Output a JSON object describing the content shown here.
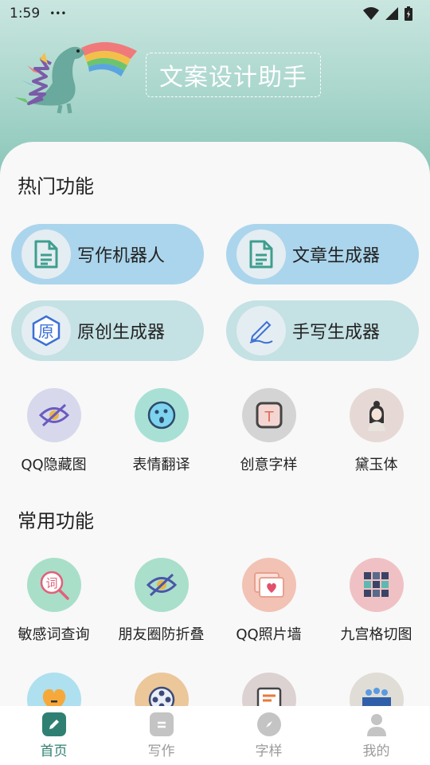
{
  "status_bar": {
    "time": "1:59",
    "dots": "•••"
  },
  "header": {
    "app_title": "文案设计助手"
  },
  "hot_section": {
    "title": "热门功能",
    "pills": [
      {
        "label": "写作机器人",
        "icon": "document-icon"
      },
      {
        "label": "文章生成器",
        "icon": "document-icon"
      },
      {
        "label": "原创生成器",
        "icon": "original-badge-icon",
        "icon_text": "原"
      },
      {
        "label": "手写生成器",
        "icon": "pen-icon"
      }
    ],
    "items": [
      {
        "label": "QQ隐藏图",
        "icon": "eye-hidden-icon"
      },
      {
        "label": "表情翻译",
        "icon": "emoji-face-icon"
      },
      {
        "label": "创意字样",
        "icon": "letter-t-icon",
        "icon_text": "T"
      },
      {
        "label": "黛玉体",
        "icon": "girl-avatar-icon"
      }
    ]
  },
  "common_section": {
    "title": "常用功能",
    "items": [
      {
        "label": "敏感词查询",
        "icon": "word-search-icon",
        "icon_text": "词"
      },
      {
        "label": "朋友圈防折叠",
        "icon": "eye-hidden-icon"
      },
      {
        "label": "QQ照片墙",
        "icon": "photo-heart-icon"
      },
      {
        "label": "九宫格切图",
        "icon": "grid-nine-icon"
      }
    ],
    "partial_items": [
      {
        "icon": "heart-face-icon"
      },
      {
        "icon": "film-reel-icon"
      },
      {
        "icon": "note-card-icon"
      },
      {
        "icon": "city-icon"
      }
    ]
  },
  "bottom_nav": {
    "items": [
      {
        "label": "首页",
        "icon": "edit-square-icon",
        "active": true
      },
      {
        "label": "写作",
        "icon": "doc-lines-icon",
        "active": false
      },
      {
        "label": "字样",
        "icon": "compass-icon",
        "active": false
      },
      {
        "label": "我的",
        "icon": "person-icon",
        "active": false
      }
    ]
  },
  "colors": {
    "header_gradient_top": "#c9e6df",
    "header_gradient_bottom": "#86c3b6",
    "pill_blue": "#abd5ec",
    "pill_teal": "#c4e1e4",
    "active_nav": "#2f8072"
  }
}
